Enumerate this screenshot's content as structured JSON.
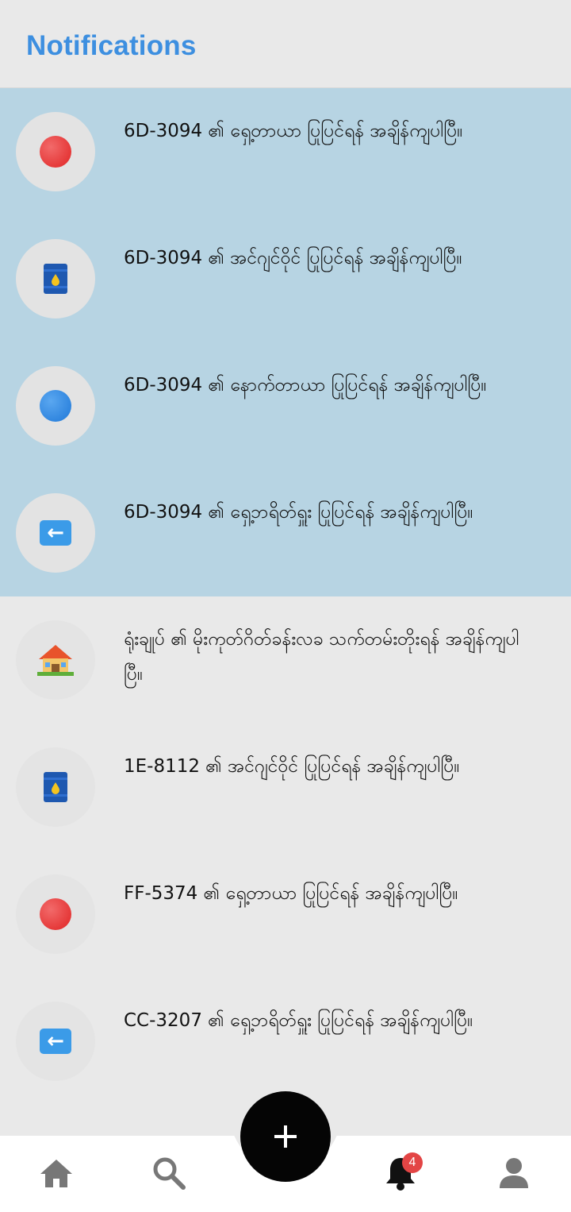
{
  "header": {
    "title": "Notifications"
  },
  "notifications": [
    {
      "text": "6D-3094 ၏ ရှေ့တာယာ ပြုပြင်ရန် အချိန်ကျပါပြီ။",
      "icon": "red-circle-icon",
      "unread": true
    },
    {
      "text": "6D-3094 ၏ အင်ဂျင်ဝိုင် ပြုပြင်ရန် အချိန်ကျပါပြီ။",
      "icon": "oil-barrel-icon",
      "unread": true
    },
    {
      "text": "6D-3094 ၏ နောက်တာယာ ပြုပြင်ရန် အချိန်ကျပါပြီ။",
      "icon": "blue-circle-icon",
      "unread": true
    },
    {
      "text": "6D-3094 ၏ ရှေ့ဘရိတ်ရှူး ပြုပြင်ရန် အချိန်ကျပါပြီ။",
      "icon": "left-arrow-icon",
      "unread": true
    },
    {
      "text": "ရုံးချုပ် ၏ မိုးကုတ်ဂိတ်ခန်းလခ သက်တမ်းတိုးရန် အချိန်ကျပါပြီ။",
      "icon": "house-icon",
      "unread": false
    },
    {
      "text": "1E-8112 ၏ အင်ဂျင်ဝိုင် ပြုပြင်ရန် အချိန်ကျပါပြီ။",
      "icon": "oil-barrel-icon",
      "unread": false
    },
    {
      "text": "FF-5374 ၏ ရှေ့တာယာ ပြုပြင်ရန် အချိန်ကျပါပြီ။",
      "icon": "red-circle-icon",
      "unread": false
    },
    {
      "text": "CC-3207 ၏ ရှေ့ဘရိတ်ရှူး ပြုပြင်ရန် အချိန်ကျပါပြီ။",
      "icon": "left-arrow-icon",
      "unread": false
    }
  ],
  "bottom_nav": {
    "items": [
      "home-icon",
      "search-icon",
      "add-icon",
      "bell-icon",
      "profile-icon"
    ],
    "notification_badge": "4"
  },
  "colors": {
    "accent": "#3d8fe0",
    "unread_bg": "#b7d4e3",
    "background": "#e9e9e9",
    "badge": "#e34545"
  }
}
